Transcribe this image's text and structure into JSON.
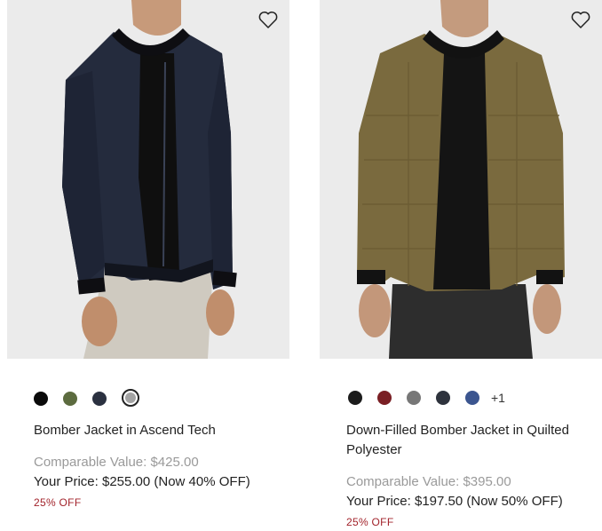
{
  "products": [
    {
      "name": "Bomber Jacket in Ascend Tech",
      "comparable": "Comparable Value: $425.00",
      "price": "Your Price: $255.00 (Now 40% OFF)",
      "discount": "25% OFF",
      "swatches": [
        "#0a0a0a",
        "#5c6b3f",
        "#2b3140",
        "#a3a3a3"
      ],
      "selected_swatch": 3,
      "more": ""
    },
    {
      "name": "Down-Filled Bomber Jacket in Quilted Polyester",
      "comparable": "Comparable Value: $395.00",
      "price": "Your Price: $197.50 (Now 50% OFF)",
      "discount": "25% OFF",
      "swatches": [
        "#1c1c1c",
        "#7a1f24",
        "#777777",
        "#2e333d",
        "#3b558f"
      ],
      "selected_swatch": 0,
      "more": "+1"
    }
  ],
  "colors": {
    "discount": "#a2232b",
    "muted": "#9a9a9a",
    "photo_bg": "#ebebeb"
  },
  "icons": {
    "wishlist": "heart-outline-icon"
  }
}
